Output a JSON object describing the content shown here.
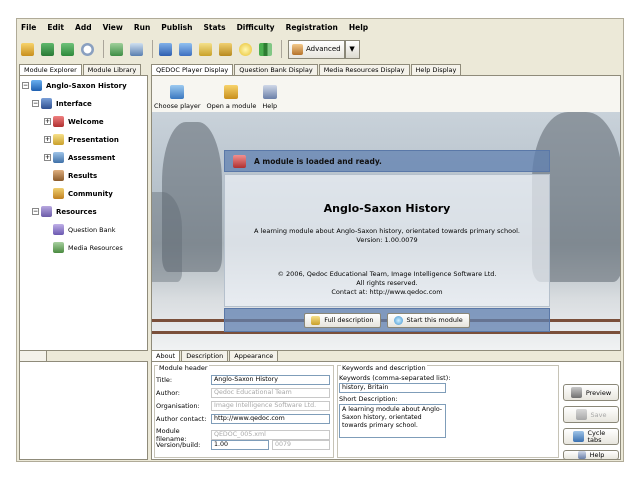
{
  "menu": [
    "File",
    "Edit",
    "Add",
    "View",
    "Run",
    "Publish",
    "Stats",
    "Difficulty",
    "Registration",
    "Help"
  ],
  "toolbar": {
    "icons": [
      "open-folder-icon",
      "save-icon",
      "save-as-icon",
      "clock-icon",
      "export-icon",
      "import-icon",
      "arrow-right-icon",
      "network-icon",
      "question-bank-icon",
      "media-icon",
      "lightbulb-icon",
      "chart-icon"
    ],
    "mode_label": "Advanced"
  },
  "left_tabs": [
    "Module Explorer",
    "Module Library"
  ],
  "main_tabs": [
    "QEDOC Player Display",
    "Question Bank Display",
    "Media Resources Display",
    "Help Display"
  ],
  "tree": {
    "root": "Anglo-Saxon History",
    "interface": "Interface",
    "interface_children": [
      "Welcome",
      "Presentation",
      "Assessment",
      "Results",
      "Community"
    ],
    "resources": "Resources",
    "resources_children": [
      "Question Bank",
      "Media Resources"
    ]
  },
  "player_toolbar": [
    "Choose player",
    "Open a module",
    "Help"
  ],
  "player": {
    "banner": "A module is loaded and ready.",
    "title": "Anglo-Saxon History",
    "description": "A learning module about Anglo-Saxon history, orientated towards primary school.",
    "version": "Version: 1.00.0079",
    "copyright": "© 2006, Qedoc Educational Team, Image Intelligence Software Ltd.",
    "rights": "All rights reserved.",
    "contact": "Contact at: http://www.qedoc.com",
    "full_description_btn": "Full description",
    "start_btn": "Start this module"
  },
  "bottom_tabs": [
    "About",
    "Description",
    "Appearance"
  ],
  "module_header": {
    "legend": "Module header",
    "title_label": "Title:",
    "title_value": "Anglo-Saxon History",
    "author_label": "Author:",
    "author_value": "Qedoc Educational Team",
    "organisation_label": "Organisation:",
    "organisation_value": "Image Intelligence Software Ltd.",
    "contact_label": "Author contact:",
    "contact_value": "http://www.qedoc.com",
    "filename_label": "Module filename:",
    "filename_value": "QEDOC_005.xml",
    "version_label": "Version/build:",
    "version_value": "1.00",
    "build_value": "0079"
  },
  "keywords": {
    "legend": "Keywords and description",
    "kw_label": "Keywords (comma-separated list):",
    "kw_value": "history, Britain",
    "sd_label": "Short Description:",
    "sd_value": "A learning module about Anglo-Saxon history, orientated towards primary school."
  },
  "side_buttons": [
    "Preview",
    "Save",
    "Cycle tabs",
    "Help"
  ],
  "colors": {
    "panel": "#ece9d8",
    "banner": "#6080b0",
    "field_border": "#7f9db9"
  }
}
